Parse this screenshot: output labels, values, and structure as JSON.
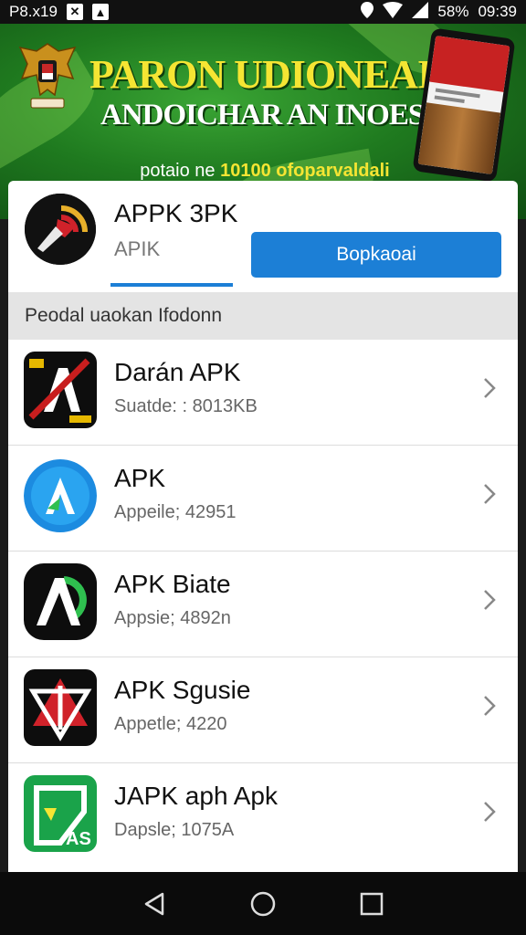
{
  "status_bar": {
    "left_text": "P8.x19",
    "right_battery": "58%",
    "time": "09:39",
    "icons": [
      "notification-x-icon",
      "notification-app-icon",
      "location-icon",
      "wifi-icon",
      "signal-icon"
    ]
  },
  "banner": {
    "title": "PARON UDIONEAIA",
    "subtitle": "ANDOICHAR AN INOESIA",
    "tag_prefix": "potaio ne ",
    "tag_highlight": "10100 ofoparvaldali",
    "colors": {
      "green": "#1f7a1f",
      "yellow": "#f5e533"
    }
  },
  "main_app": {
    "icon": "wifi-wave-icon",
    "title": "APPK 3PK",
    "subtitle": "APIK",
    "button_label": "Bopkaoai",
    "accent": "#1c7fd6"
  },
  "section_header": "Peodal uaokan Ifodonn",
  "apps": [
    {
      "name": "Darán APK",
      "meta": "Suatde: : 8013KB",
      "icon": "a-slash-icon"
    },
    {
      "name": "APK",
      "meta": "Appeile; 42951",
      "icon": "a-blue-circle-icon"
    },
    {
      "name": "APK Biate",
      "meta": "Appsie; 4892n",
      "icon": "ap-logo-icon"
    },
    {
      "name": "APK Sgusie",
      "meta": "Appetle; 4220",
      "icon": "a-star-icon"
    },
    {
      "name": "JAPK aph Apk",
      "meta": "Dapsle; 1075A",
      "icon": "green-a-icon"
    }
  ],
  "nav_bar": {
    "icons": [
      "back-icon",
      "home-icon",
      "recents-icon"
    ]
  }
}
